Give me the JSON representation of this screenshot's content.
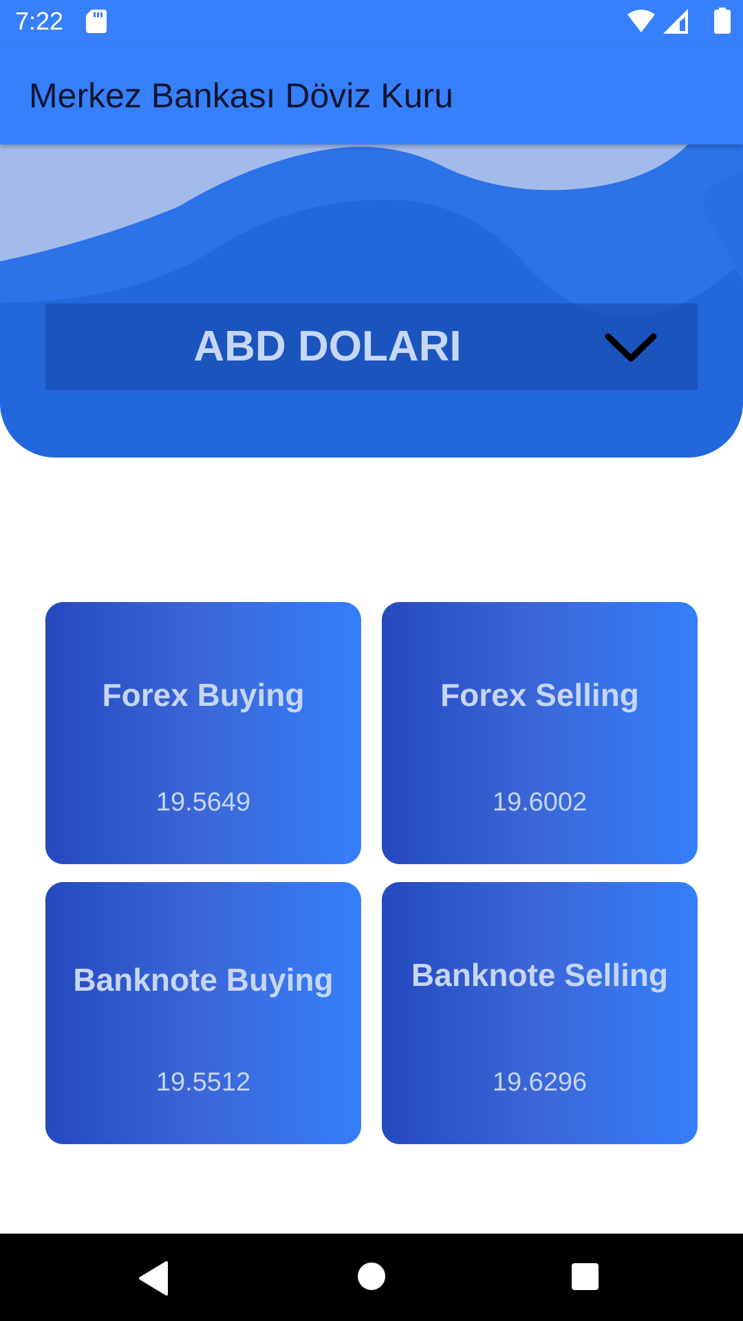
{
  "status_bar": {
    "time": "7:22",
    "icons": [
      "sd-card-icon",
      "wifi-icon",
      "signal-icon",
      "battery-icon"
    ]
  },
  "app_bar": {
    "title": "Merkez Bankası Döviz Kuru"
  },
  "currency_select": {
    "selected": "ABD DOLARI",
    "icon": "chevron-down-icon"
  },
  "rates": [
    {
      "label": "Forex Buying",
      "value": "19.5649"
    },
    {
      "label": "Forex Selling",
      "value": "19.6002"
    },
    {
      "label": "Banknote Buying",
      "value": "19.5512"
    },
    {
      "label": "Banknote Selling",
      "value": "19.6296"
    }
  ],
  "nav_bar": {
    "icons": [
      "back-icon",
      "home-icon",
      "recents-icon"
    ]
  },
  "colors": {
    "primary": "#3780fb",
    "header_wave": "#2268dc",
    "card_gradient_start": "#2549bf",
    "card_gradient_end": "#357ffa",
    "card_text": "#c6d6f2"
  }
}
